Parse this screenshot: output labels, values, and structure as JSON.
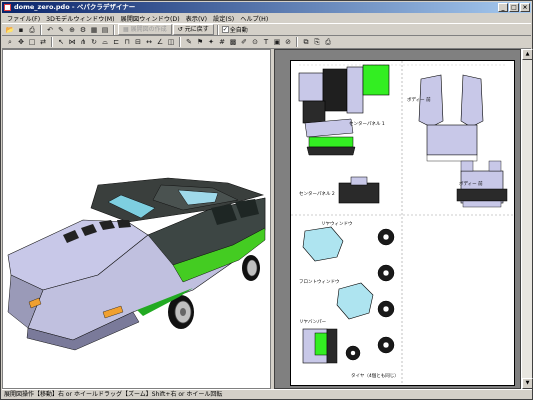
{
  "window": {
    "title": "dome_zero.pdo - ペパクラデザイナー"
  },
  "menu": [
    "ファイル(F)",
    "3Dモデルウィンドウ(M)",
    "展開図ウィンドウ(D)",
    "表示(V)",
    "設定(S)",
    "ヘルプ(H)"
  ],
  "toolbar": {
    "unfold_label": "展開図の作成",
    "restore_label": "元に戻す",
    "auto_move_label": "全自動",
    "auto_move_checked": "✓"
  },
  "pattern_labels": {
    "center_panel_1": "センターパネル 1",
    "center_panel_2": "センターパネル 2",
    "body_left": "ボディー 前",
    "body_right": "ボディー 前",
    "side_window": "リヤウィンドウ",
    "front_window": "フロントウィンドウ",
    "bumper": "リヤバンパー",
    "tires": "タイヤ（4個とも同じ）"
  },
  "statusbar": {
    "text": "展開図操作【移動】右 or ホイールドラッグ【ズーム】Shift+右 or ホイール回転"
  },
  "colors": {
    "titlebar": "#0a246a",
    "panel_green": "#33ee22",
    "body_lavender": "#c8c8e8"
  }
}
